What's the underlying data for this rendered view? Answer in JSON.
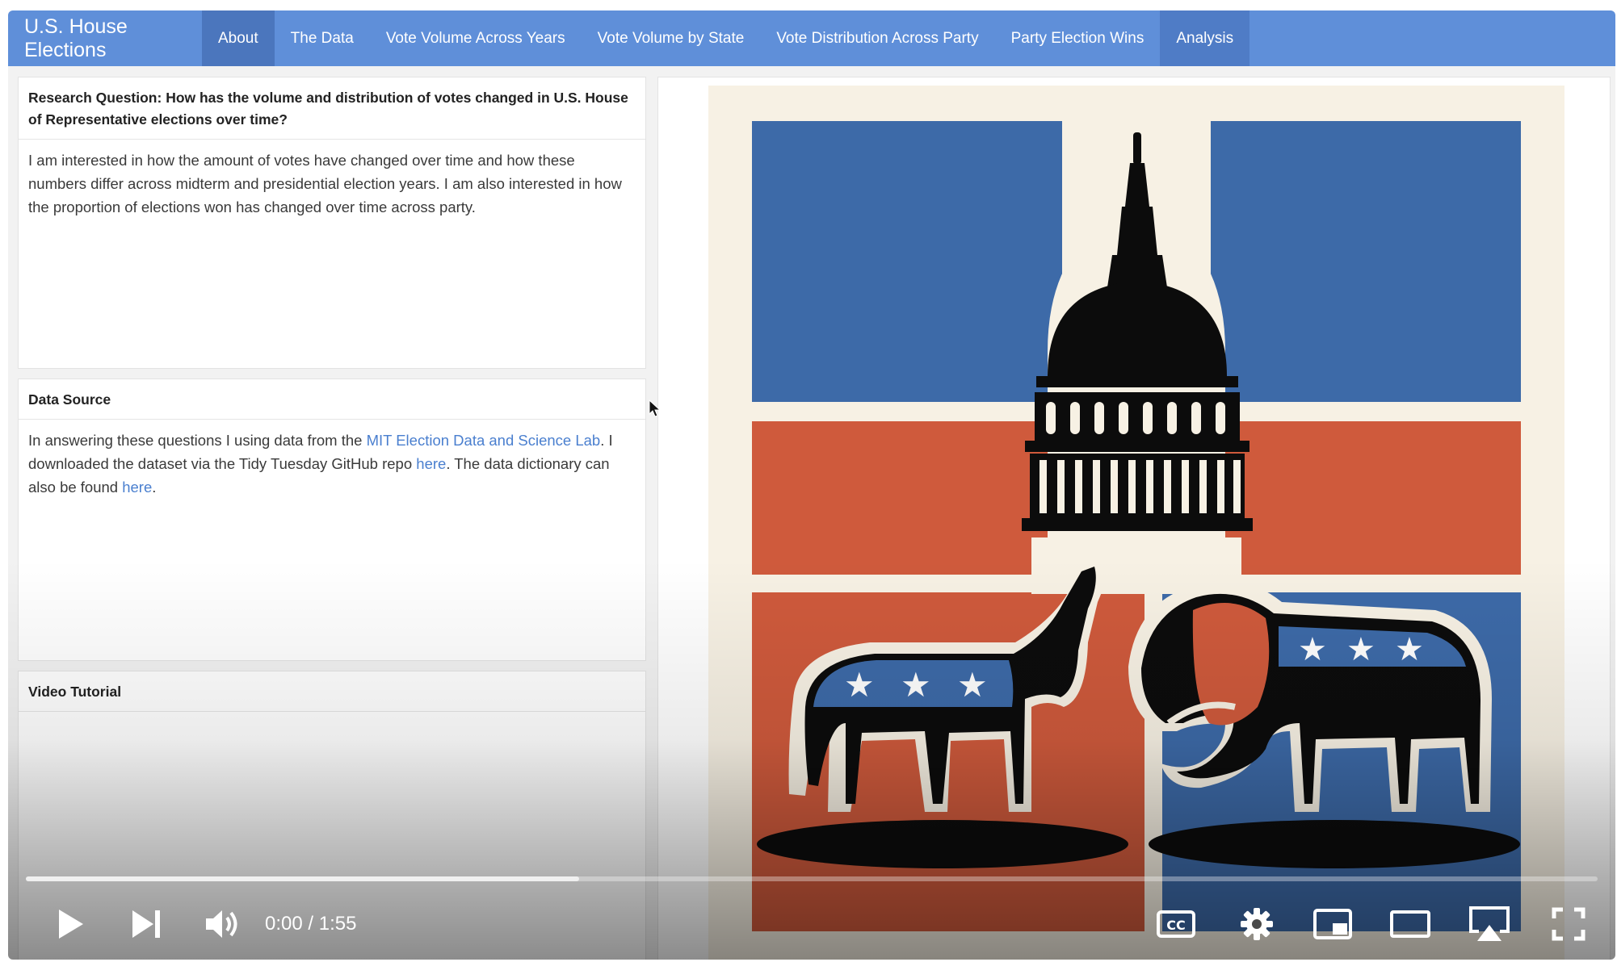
{
  "navbar": {
    "brand": "U.S. House Elections",
    "items": [
      {
        "label": "About"
      },
      {
        "label": "The Data"
      },
      {
        "label": "Vote Volume Across Years"
      },
      {
        "label": "Vote Volume by State"
      },
      {
        "label": "Vote Distribution Across Party"
      },
      {
        "label": "Party Election Wins"
      },
      {
        "label": "Analysis"
      }
    ],
    "active_index": 0,
    "color": "#5f8fd9"
  },
  "research": {
    "heading": "Research Question: How has the volume and distribution of votes changed in U.S. House of Representative elections over time?",
    "body": "I am interested in how the amount of votes have changed over time and how these numbers differ across midterm and presidential election years. I am also interested in how the proportion of elections won has changed over time across party."
  },
  "data_source": {
    "heading": "Data Source",
    "text_1": "In answering these questions I using data from the ",
    "link_1": "MIT Election Data and Science Lab",
    "text_2": ". I downloaded the dataset via the Tidy Tuesday GitHub repo ",
    "link_2": "here",
    "text_3": ". The data dictionary can also be found ",
    "link_3": "here",
    "text_4": "."
  },
  "video_tutorial": {
    "heading": "Video Tutorial"
  },
  "player": {
    "time": "0:00 / 1:55",
    "buffered_fraction": 0.352,
    "played_fraction": 0.0,
    "icons": [
      "play-icon",
      "next-icon",
      "volume-icon",
      "captions-icon",
      "settings-icon",
      "miniplayer-icon",
      "theater-icon",
      "airplay-icon",
      "fullscreen-icon"
    ]
  },
  "colors": {
    "blue": "#3d6aa8",
    "red": "#cf5a3c",
    "cream": "#f7f1e4",
    "black": "#0c0c0c"
  }
}
